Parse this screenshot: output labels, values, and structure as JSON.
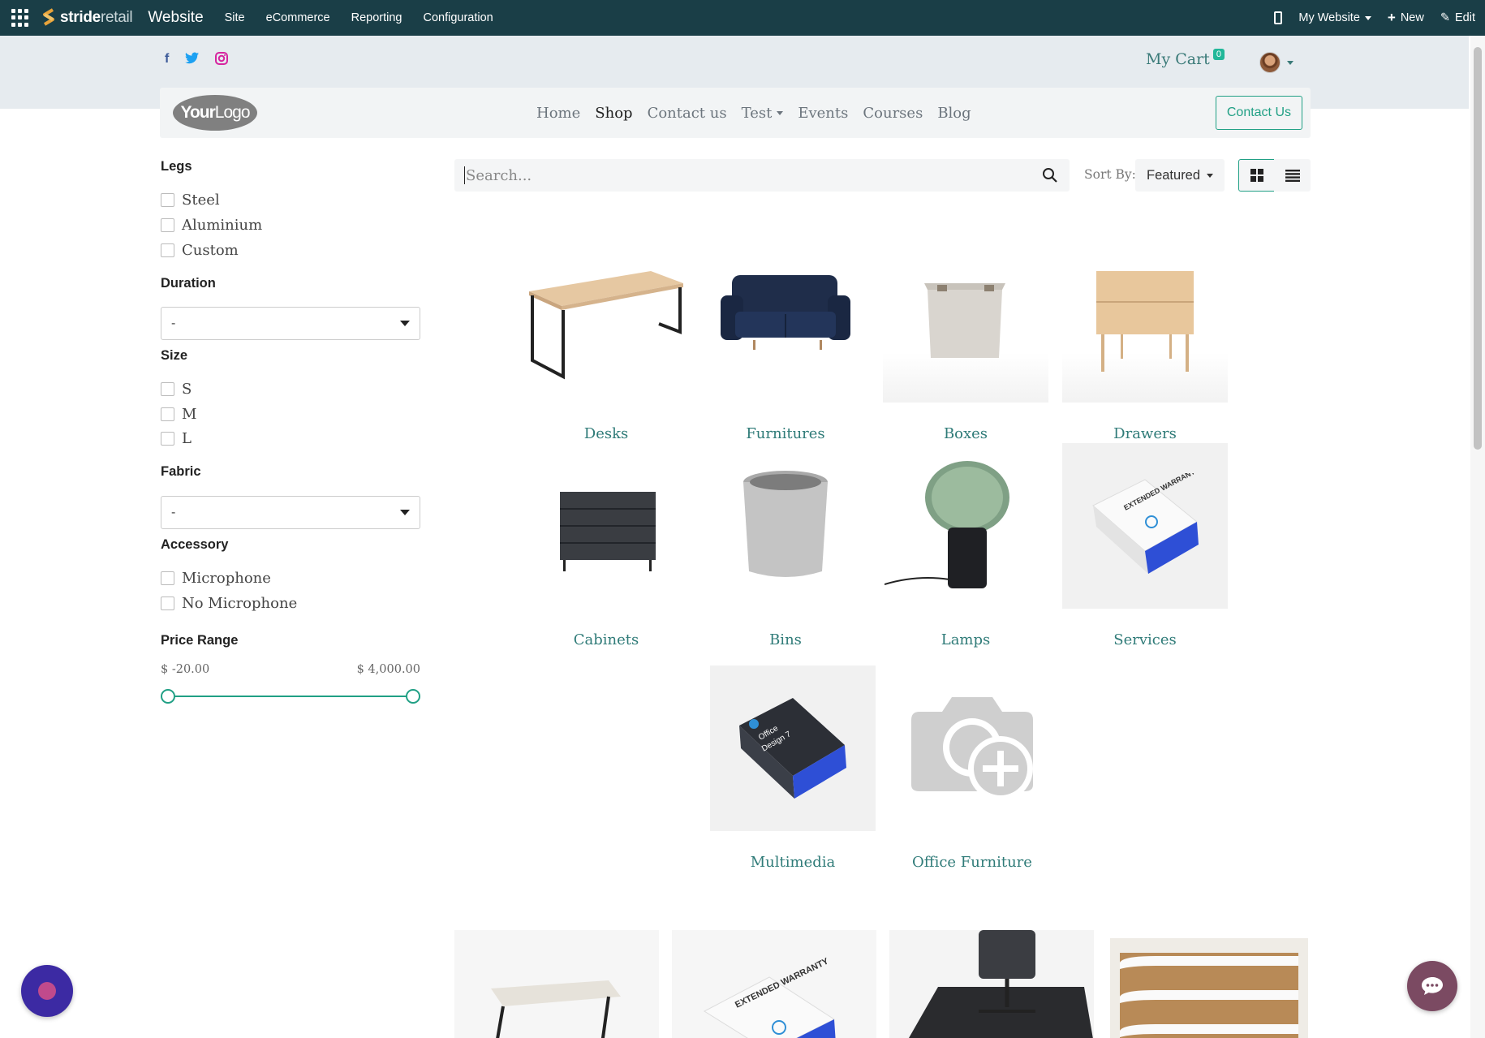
{
  "adminbar": {
    "brand_bold": "stride",
    "brand_light": "retail",
    "app_name": "Website",
    "menu": [
      "Site",
      "eCommerce",
      "Reporting",
      "Configuration"
    ],
    "website_label": "My Website",
    "new_label": "New",
    "edit_label": "Edit"
  },
  "header": {
    "cart_label": "My Cart",
    "cart_count": "0",
    "logo_bold": "Your",
    "logo_light": "Logo",
    "nav": [
      "Home",
      "Shop",
      "Contact us",
      "Test",
      "Events",
      "Courses",
      "Blog"
    ],
    "active_nav": "Shop",
    "contact_button": "Contact Us",
    "social_icons": [
      "facebook-icon",
      "twitter-icon",
      "instagram-icon"
    ]
  },
  "sidebar": {
    "legs": {
      "title": "Legs",
      "options": [
        "Steel",
        "Aluminium",
        "Custom"
      ]
    },
    "duration": {
      "title": "Duration",
      "value": "-"
    },
    "size": {
      "title": "Size",
      "options": [
        "S",
        "M",
        "L"
      ]
    },
    "fabric": {
      "title": "Fabric",
      "value": "-"
    },
    "accessory": {
      "title": "Accessory",
      "options": [
        "Microphone",
        "No Microphone"
      ]
    },
    "price": {
      "title": "Price Range",
      "min_label": "$ -20.00",
      "max_label": "$ 4,000.00",
      "min_fraction": 0,
      "max_fraction": 1
    }
  },
  "search": {
    "placeholder": "Search...",
    "sort_label": "Sort By:",
    "sort_value": "Featured"
  },
  "categories": [
    "Desks",
    "Furnitures",
    "Boxes",
    "Drawers",
    "Cabinets",
    "Bins",
    "Lamps",
    "Services",
    "Multimedia",
    "Office Furniture"
  ],
  "product_texts": {
    "services_box": "EXTENDED WARRANTY",
    "multimedia_box_1": "Office",
    "multimedia_box_2": "Design 7",
    "warranty_box": "EXTENDED WARRANTY"
  },
  "colors": {
    "admin_bg": "#1a3e47",
    "accent": "#21a085",
    "link": "#2f7b78"
  }
}
